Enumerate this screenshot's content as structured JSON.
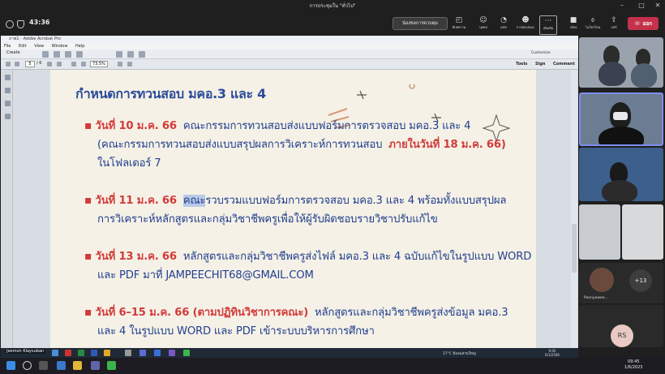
{
  "meeting": {
    "title": "การประชุมใน \"ทั่วไป\"",
    "timer": "43:36",
    "request_button": "น้องขอการควบคุม",
    "tools": [
      {
        "label": "มีบทความ",
        "icon": "chat-icon"
      },
      {
        "label": "บุคคล",
        "icon": "people-icon"
      },
      {
        "label": "แชท",
        "icon": "chat-icon"
      },
      {
        "label": "การตอบสนอง",
        "icon": "react-icon"
      },
      {
        "label": "เพิ่มเติม",
        "icon": "more-icon"
      },
      {
        "label": "กล้อง",
        "icon": "camera-icon"
      },
      {
        "label": "ไมโครโฟน",
        "icon": "mic-icon"
      },
      {
        "label": "แชร์",
        "icon": "share-icon"
      }
    ],
    "leave_button": "ออก",
    "participants": {
      "extra_count": "+13",
      "named_participant": "Poonyawee...",
      "initials": "RS"
    }
  },
  "acrobat": {
    "window_title": "ภาพ1 - Adobe Acrobat Pro",
    "menu": [
      "File",
      "Edit",
      "View",
      "Window",
      "Help"
    ],
    "create_label": "Create",
    "customize_label": "Customize",
    "page_current": "5",
    "page_total": "/ 6",
    "zoom": "73.5%",
    "right_links": [
      "Tools",
      "Sign",
      "Comment"
    ]
  },
  "slide": {
    "title": "กำหนดการทวนสอบ มคอ.3 และ 4",
    "items": [
      {
        "date": "วันที่ 10 ม.ค. 66",
        "text1": "คณะกรรมการทวนสอบส่งแบบฟอร์มการตรวจสอบ มคอ.3 และ 4",
        "text2a": "(คณะกรรมการทวนสอบส่งแบบสรุปผลการวิเคราะห์การทวนสอบ",
        "text2b": "ภายในวันที่ 18 ม.ค. 66)",
        "text3": "ในโฟลเดอร์ 7"
      },
      {
        "date": "วันที่ 11 ม.ค. 66",
        "highlight": "คณะ",
        "text1": "รวบรวมแบบฟอร์มการตรวจสอบ มคอ.3 และ 4 พร้อมทั้งแบบสรุปผล",
        "text2": "การวิเคราะห์หลักสูตรและกลุ่มวิชาชีพครูเพื่อให้ผู้รับผิดชอบรายวิชาปรับแก้ไข"
      },
      {
        "date": "วันที่ 13 ม.ค. 66",
        "text1": "หลักสูตรและกลุ่มวิชาชีพครูส่งไฟล์ มคอ.3 และ 4 ฉบับแก้ไขในรูปแบบ WORD",
        "text2": "และ PDF มาที่ JAMPEECHIT68@GMAIL.COM"
      },
      {
        "date": "วันที่ 6–15 ม.ค. 66 (ตามปฏิทินวิชาการคณะ)",
        "text1": "หลักสูตรและกลุ่มวิชาชีพครูส่งข้อมูล มคอ.3",
        "text2": "และ 4 ในรูปแบบ WORD และ PDF เข้าระบบบริหารการศึกษา"
      }
    ]
  },
  "presenter_bar": {
    "name": "Jeemon Klaysuban",
    "weather": "27°C มีเมฆส่วนใหญ่",
    "time": "9:45",
    "date": "6/1/2566"
  },
  "taskbar": {
    "time": "09:45",
    "date": "1/6/2023"
  },
  "colors": {
    "title_blue": "#2a4b9b",
    "date_red": "#d23a3a",
    "leave_red": "#c4314b",
    "slide_bg": "#f5f1e6"
  }
}
